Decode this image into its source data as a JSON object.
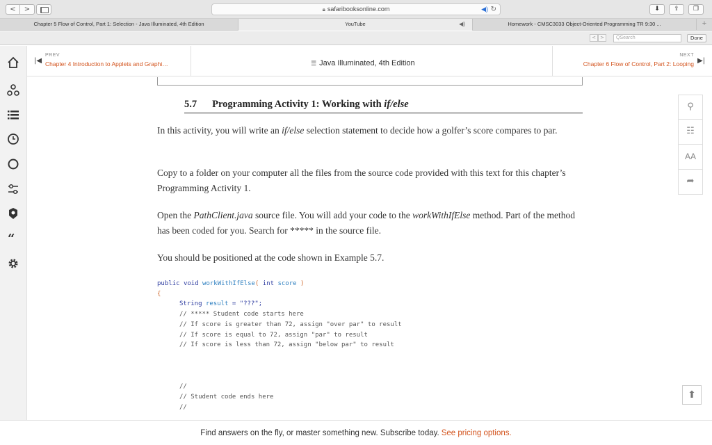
{
  "browser": {
    "url": "safaribooksonline.com",
    "tabs": [
      {
        "label": "Chapter 5 Flow of Control, Part 1: Selection - Java Illuminated, 4th Edition",
        "active": true
      },
      {
        "label": "YouTube",
        "active": false
      },
      {
        "label": "Homework - CMSC3033 Object-Oriented Programming TR 9:30 ...",
        "active": false
      }
    ],
    "find": {
      "placeholder": "Search",
      "done_label": "Done"
    }
  },
  "rail": {
    "icons": [
      "home-icon",
      "network-icon",
      "list-icon",
      "clock-icon",
      "circle-icon",
      "sliders-icon",
      "badge-icon",
      "quote-icon",
      "gear-icon"
    ]
  },
  "chapnav": {
    "prev_label": "PREV",
    "prev_title": "Chapter 4 Introduction to Applets and Graphi…",
    "book_title": "Java Illuminated, 4th Edition",
    "next_label": "NEXT",
    "next_title": "Chapter 6 Flow of Control, Part 2: Looping"
  },
  "content": {
    "section_number": "5.7",
    "section_title": "Programming Activity 1: Working with ",
    "section_title_em": "if/else",
    "p1": {
      "a": "In this activity, you will write an ",
      "b": "if/else",
      "c": " selection statement to decide how a golfer’s score compares to par."
    },
    "p2": "Copy to a folder on your computer all the files from the source code provided with this text for this chapter’s Programming Activity 1.",
    "p3": {
      "a": "Open the ",
      "b": "PathClient.java",
      "c": " source file. You will add your code to the ",
      "d": "workWithIfElse",
      "e": " method. Part of the method has been coded for you. Search for ***** in the source file."
    },
    "p4": "You should be positioned at the code shown in Example 5.7.",
    "code": {
      "sig_public": "public",
      "sig_void": "void",
      "sig_name": "workWithIfElse",
      "sig_open": "(",
      "sig_int": "int",
      "sig_param": "score",
      "sig_close": ")",
      "brace": "{",
      "decl_type": "String",
      "decl_name": "result",
      "decl_rest": " = \"???\";",
      "lines": [
        "// ***** Student code starts here",
        "// If score is greater than 72, assign \"over par\" to result",
        "// If score is equal to 72, assign \"par\" to result",
        "// If score is less than 72, assign \"below par\" to result"
      ],
      "end_lines": [
        "//",
        "// Student code ends here",
        "//"
      ]
    }
  },
  "banner": {
    "text": "Find answers on the fly, or master something new. Subscribe today.",
    "link": "See pricing options."
  },
  "colors": {
    "accent": "#d3541e",
    "keyword": "#2b3a9f",
    "function": "#2d7fc0"
  }
}
